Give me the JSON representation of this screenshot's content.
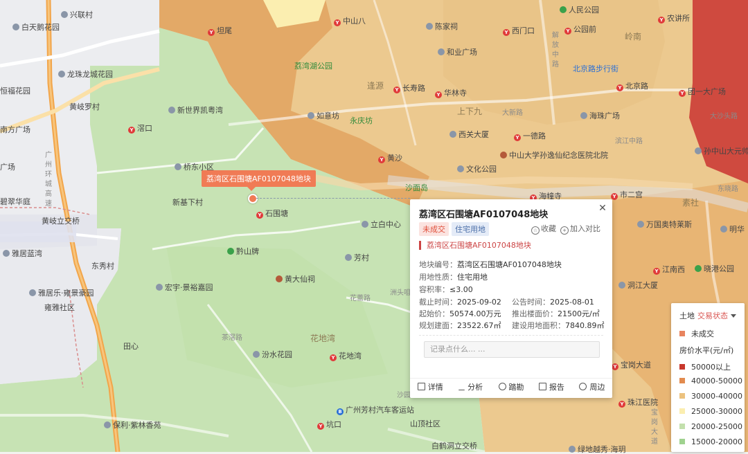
{
  "map": {
    "colors": {
      "green": "#c7e3b4",
      "beige": "#ecc98f",
      "orange": "#e3a967",
      "red": "#cf4a3f",
      "yellow": "#fbeeb0",
      "gray": "#ecedf0"
    },
    "labels": [
      {
        "text": "兴联村",
        "type": "poi"
      },
      {
        "text": "白天鹅花园",
        "type": "poi"
      },
      {
        "text": "坦尾",
        "type": "metro"
      },
      {
        "text": "中山八",
        "type": "metro"
      },
      {
        "text": "陈家祠",
        "type": "poi"
      },
      {
        "text": "西门口",
        "type": "metro"
      },
      {
        "text": "人民公园",
        "type": "park"
      },
      {
        "text": "公园前",
        "type": "metro"
      },
      {
        "text": "农讲所",
        "type": "metro"
      },
      {
        "text": "和业广场",
        "type": "poi"
      },
      {
        "text": "荔湾湖公园",
        "type": "green"
      },
      {
        "text": "岭南",
        "type": "area"
      },
      {
        "text": "解放中路",
        "type": "road"
      },
      {
        "text": "北京路步行街",
        "type": "blue"
      },
      {
        "text": "龙珠龙城花园",
        "type": "poi"
      },
      {
        "text": "逢源",
        "type": "area"
      },
      {
        "text": "长寿路",
        "type": "metro"
      },
      {
        "text": "华林寺",
        "type": "metro"
      },
      {
        "text": "北京路",
        "type": "metro"
      },
      {
        "text": "团一大广场",
        "type": "metro"
      },
      {
        "text": "恒福花园",
        "type": "plain"
      },
      {
        "text": "黄岐罗村",
        "type": "plain"
      },
      {
        "text": "新世界凯粤湾",
        "type": "poi"
      },
      {
        "text": "如意坊",
        "type": "poi"
      },
      {
        "text": "永庆坊",
        "type": "green"
      },
      {
        "text": "上下九",
        "type": "area"
      },
      {
        "text": "大新路",
        "type": "road"
      },
      {
        "text": "海珠广场",
        "type": "poi"
      },
      {
        "text": "大沙头路",
        "type": "road"
      },
      {
        "text": "南方广场",
        "type": "plain"
      },
      {
        "text": "滘口",
        "type": "metro"
      },
      {
        "text": "西关大厦",
        "type": "poi"
      },
      {
        "text": "一德路",
        "type": "metro"
      },
      {
        "text": "滨江中路",
        "type": "road"
      },
      {
        "text": "孙中山大元帅府纪念馆",
        "type": "poi"
      },
      {
        "text": "广场",
        "type": "plain"
      },
      {
        "text": "桥东小区",
        "type": "poi"
      },
      {
        "text": "黄沙",
        "type": "metro"
      },
      {
        "text": "中山大学孙逸仙纪念医院北院",
        "type": "temple"
      },
      {
        "text": "文化公园",
        "type": "poi"
      },
      {
        "text": "沙面岛",
        "type": "green"
      },
      {
        "text": "海幢寺",
        "type": "metro"
      },
      {
        "text": "市二宫",
        "type": "metro"
      },
      {
        "text": "素社",
        "type": "area"
      },
      {
        "text": "东晓路",
        "type": "road"
      },
      {
        "text": "新基下村",
        "type": "plain"
      },
      {
        "text": "碧翠华庭",
        "type": "plain"
      },
      {
        "text": "石围塘",
        "type": "metro"
      },
      {
        "text": "黄岐立交桥",
        "type": "plain"
      },
      {
        "text": "立白中心",
        "type": "poi"
      },
      {
        "text": "万国奥特莱斯",
        "type": "poi"
      },
      {
        "text": "明华",
        "type": "poi"
      },
      {
        "text": "雅居蓝湾",
        "type": "poi"
      },
      {
        "text": "黔山牌",
        "type": "park"
      },
      {
        "text": "芳村",
        "type": "poi"
      },
      {
        "text": "东秀村",
        "type": "plain"
      },
      {
        "text": "黄大仙祠",
        "type": "temple"
      },
      {
        "text": "江南西",
        "type": "metro"
      },
      {
        "text": "晓港公园",
        "type": "park"
      },
      {
        "text": "雅居乐·雍景豪园",
        "type": "poi"
      },
      {
        "text": "宏宇·景裕嘉园",
        "type": "poi"
      },
      {
        "text": "洞江大厦",
        "type": "poi"
      },
      {
        "text": "雍雅社区",
        "type": "plain"
      },
      {
        "text": "花蕾路",
        "type": "road"
      },
      {
        "text": "洲头咀",
        "type": "road"
      },
      {
        "text": "田心",
        "type": "plain"
      },
      {
        "text": "花地湾",
        "type": "area"
      },
      {
        "text": "茶滘路",
        "type": "road"
      },
      {
        "text": "汾水花园",
        "type": "poi"
      },
      {
        "text": "花地湾",
        "type": "metro"
      },
      {
        "text": "宝岗大道",
        "type": "metro"
      },
      {
        "text": "广州芳村汽车客运站",
        "type": "bus"
      },
      {
        "text": "珠江医院",
        "type": "metro"
      },
      {
        "text": "保利·紫林香苑",
        "type": "poi"
      },
      {
        "text": "坑口",
        "type": "metro"
      },
      {
        "text": "山顶社区",
        "type": "plain"
      },
      {
        "text": "白鹤洞立交桥",
        "type": "plain"
      },
      {
        "text": "广州环城高速",
        "type": "road"
      },
      {
        "text": "宝岗大道",
        "type": "road"
      },
      {
        "text": "沙园",
        "type": "road"
      },
      {
        "text": "绿地越秀·海玥",
        "type": "poi"
      }
    ],
    "marker_label": "荔湾区石围塘AF0107048地块"
  },
  "popup": {
    "title": "荔湾区石围塘AF0107048地块",
    "tag_status": "未成交",
    "tag_use": "住宅用地",
    "favorite_label": "收藏",
    "compare_label": "加入对比",
    "subheading": "荔湾区石围塘AF0107048地块",
    "fields": {
      "plot_no": {
        "k": "地块编号：",
        "v": "荔湾区石围塘AF0107048地块"
      },
      "land_use": {
        "k": "用地性质：",
        "v": "住宅用地"
      },
      "far": {
        "k": "容积率：",
        "v": "≤3.00"
      },
      "deadline": {
        "k": "截止时间：",
        "v": "2025-09-02"
      },
      "announce": {
        "k": "公告时间：",
        "v": "2025-08-01"
      },
      "start_price": {
        "k": "起始价：",
        "v": "50574.00万元"
      },
      "floor_price": {
        "k": "推出楼面价：",
        "v": "21500元/㎡"
      },
      "build_area": {
        "k": "规划建面：",
        "v": "23522.67㎡"
      },
      "land_area": {
        "k": "建设用地面积：",
        "v": "7840.89㎡"
      }
    },
    "memo_placeholder": "记录点什么... ...",
    "tools": [
      "详情",
      "分析",
      "踏勘",
      "报告",
      "周边"
    ]
  },
  "legend": {
    "head_label": "土地",
    "head_select": "交易状态",
    "status_items": [
      {
        "label": "未成交",
        "color": "#e8845f"
      }
    ],
    "price_title": "房价水平(元/㎡)",
    "price_items": [
      {
        "label": "50000以上",
        "color": "#c8372c"
      },
      {
        "label": "40000-50000",
        "color": "#e28b4f"
      },
      {
        "label": "30000-40000",
        "color": "#ecc27f"
      },
      {
        "label": "25000-30000",
        "color": "#fbeeb0"
      },
      {
        "label": "20000-25000",
        "color": "#c3e0ad"
      },
      {
        "label": "15000-20000",
        "color": "#9fd28f"
      }
    ]
  }
}
